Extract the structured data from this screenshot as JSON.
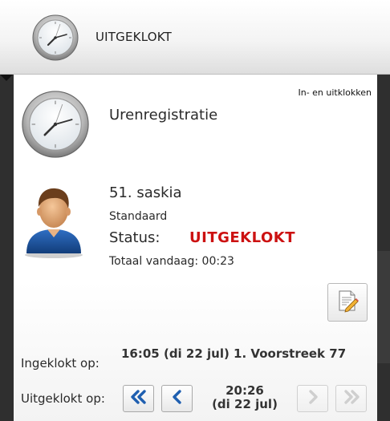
{
  "header": {
    "title": "UITGEKLOKT",
    "icon": "clock-icon"
  },
  "panel": {
    "hint": "In- en uitklokken",
    "heading": "Urenregistratie",
    "heading_icon": "clock-icon"
  },
  "user": {
    "avatar_icon": "user-avatar-icon",
    "name": "51. saskia",
    "schedule": "Standaard",
    "status_label": "Status:",
    "status_value": "UITGEKLOKT",
    "status_color": "#cc1111",
    "total": "Totaal vandaag: 00:23"
  },
  "actions": {
    "note_icon": "edit-note-icon"
  },
  "clocked_in": {
    "label": "Ingeklokt op:",
    "value": "16:05 (di 22 jul)  1. Voorstreek 77"
  },
  "clocked_out": {
    "label": "Uitgeklokt op:",
    "time": "20:26",
    "date": "(di 22 jul)",
    "first_icon": "double-chevron-left-icon",
    "prev_icon": "chevron-left-icon",
    "next_icon": "chevron-right-icon",
    "last_icon": "double-chevron-right-icon",
    "accent": "#1f5fb0"
  }
}
